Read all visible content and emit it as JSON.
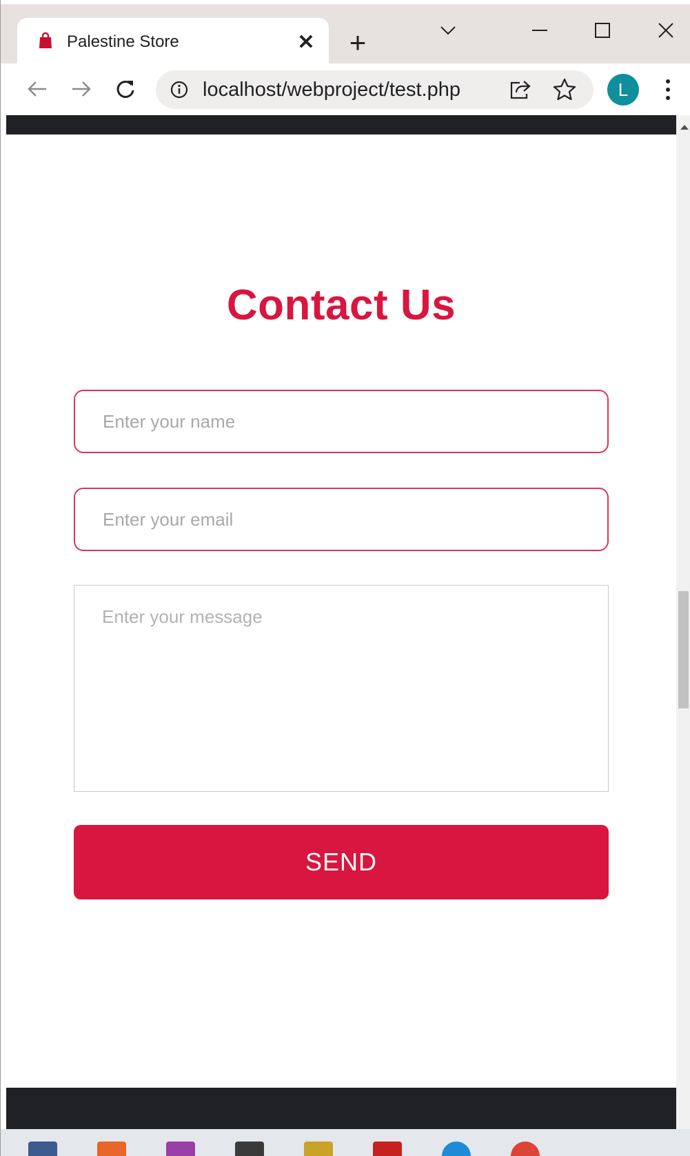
{
  "browser": {
    "tab": {
      "title": "Palestine Store",
      "close_glyph": "✕",
      "favicon": "shopping-bag-icon"
    },
    "new_tab_glyph": "+",
    "address": {
      "url": "localhost/webproject/test.php"
    },
    "profile_initial": "L",
    "icons": [
      "back-arrow-icon",
      "forward-arrow-icon",
      "reload-icon",
      "info-icon",
      "share-icon",
      "star-icon",
      "kebab-menu-icon",
      "tab-search-icon",
      "minimize-icon",
      "maximize-icon",
      "close-window-icon"
    ]
  },
  "page": {
    "title": "Contact Us",
    "form": {
      "name_placeholder": "Enter your name",
      "email_placeholder": "Enter your email",
      "message_placeholder": "Enter your message",
      "send_label": "SEND"
    }
  },
  "colors": {
    "accent": "#d8163f",
    "nav_bar": "#202124",
    "avatar": "#0f8f9c"
  },
  "taskbar": {
    "apps": [
      "file-manager-icon",
      "xampp-icon",
      "phpstorm-icon",
      "app-icon",
      "media-icon",
      "gmail-icon",
      "edge-icon",
      "chrome-icon"
    ]
  }
}
